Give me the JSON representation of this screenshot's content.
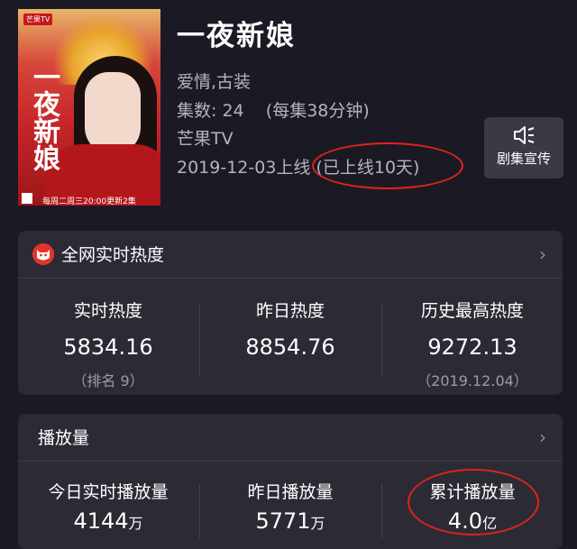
{
  "show": {
    "title": "一夜新娘",
    "genre": "爱情,古装",
    "episodes": "集数: 24    (每集38分钟)",
    "platform": "芒果TV",
    "release": "2019-12-03上线 (已上线10天)"
  },
  "poster": {
    "brand": "芒果TV",
    "title": "一夜新娘",
    "schedule": "每周二周三20:00更新2集"
  },
  "promo_button": {
    "label": "剧集宣传",
    "icon": "speaker-icon"
  },
  "heat_card": {
    "title": "全网实时热度",
    "icon": "cat-logo-icon",
    "stats": [
      {
        "label": "实时热度",
        "value": "5834.16",
        "sub": "（排名 9）"
      },
      {
        "label": "昨日热度",
        "value": "8854.76",
        "sub": ""
      },
      {
        "label": "历史最高热度",
        "value": "9272.13",
        "sub": "（2019.12.04）"
      }
    ]
  },
  "play_card": {
    "title": "播放量",
    "stats": [
      {
        "label": "今日实时播放量",
        "value": "4144",
        "unit": "万"
      },
      {
        "label": "昨日播放量",
        "value": "5771",
        "unit": "万"
      },
      {
        "label": "累计播放量",
        "value": "4.0",
        "unit": "亿"
      }
    ]
  },
  "colors": {
    "background": "#1b1a24",
    "card": "#2c2b35",
    "annotation_red": "#e0231d",
    "brand_red": "#e33428"
  }
}
